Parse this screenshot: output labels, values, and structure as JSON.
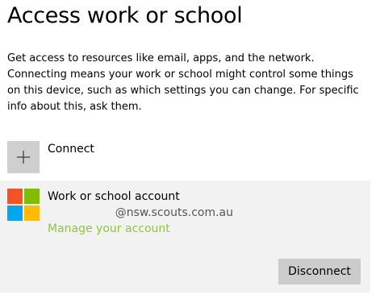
{
  "header": {
    "title": "Access work or school"
  },
  "description": "Get access to resources like email, apps, and the network. Connecting means your work or school might control some things on this device, such as which settings you can change. For specific info about this, ask them.",
  "connect": {
    "icon": "plus-icon",
    "label": "Connect"
  },
  "account": {
    "logo": "microsoft-logo",
    "logo_colors": [
      "#f35325",
      "#81bc06",
      "#05a6f0",
      "#ffba08"
    ],
    "name": "Work or school account",
    "email": "@nsw.scouts.com.au",
    "manage_label": "Manage your account",
    "disconnect_label": "Disconnect"
  },
  "colors": {
    "accent_link": "#8cc63f",
    "panel_background": "#f2f2f2",
    "button_background": "#cccccc"
  }
}
